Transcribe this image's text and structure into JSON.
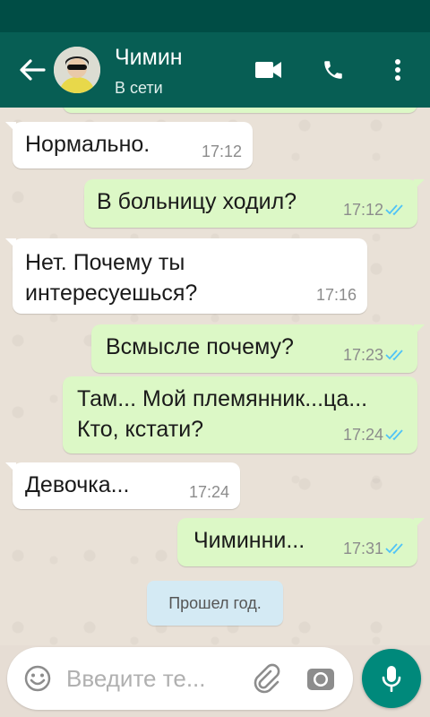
{
  "header": {
    "contact_name": "Чимин",
    "contact_status": "В сети",
    "back_icon": "arrow-left-icon",
    "video_call_icon": "video-camera-icon",
    "voice_call_icon": "phone-icon",
    "menu_icon": "more-vert-icon"
  },
  "messages": [
    {
      "direction": "in",
      "lines": [
        "Нормально."
      ],
      "time": "17:12"
    },
    {
      "direction": "out",
      "lines": [
        "В больницу ходил?"
      ],
      "time": "17:12",
      "read": true
    },
    {
      "direction": "in",
      "lines": [
        "Нет. Почему ты",
        "интересуешься?"
      ],
      "time": "17:16"
    },
    {
      "direction": "out",
      "lines": [
        "Всмысле почему?"
      ],
      "time": "17:23",
      "read": true
    },
    {
      "direction": "out",
      "lines": [
        "Там... Мой племянник...ца...",
        "Кто, кстати?"
      ],
      "time": "17:24",
      "read": true
    },
    {
      "direction": "in",
      "lines": [
        "Девочка..."
      ],
      "time": "17:24"
    },
    {
      "direction": "out",
      "lines": [
        "Чиминни..."
      ],
      "time": "17:31",
      "read": true
    }
  ],
  "notice": "Прошел год.",
  "composer": {
    "placeholder": "Введите те...",
    "emoji_icon": "emoji-icon",
    "attach_icon": "paperclip-icon",
    "camera_icon": "camera-icon",
    "mic_icon": "microphone-icon"
  },
  "colors": {
    "app_bar": "#075e54",
    "status_bar": "#004d45",
    "outgoing_bubble": "#dcf8c6",
    "incoming_bubble": "#ffffff",
    "read_check": "#4fc3f7",
    "mic_button": "#00897b"
  }
}
